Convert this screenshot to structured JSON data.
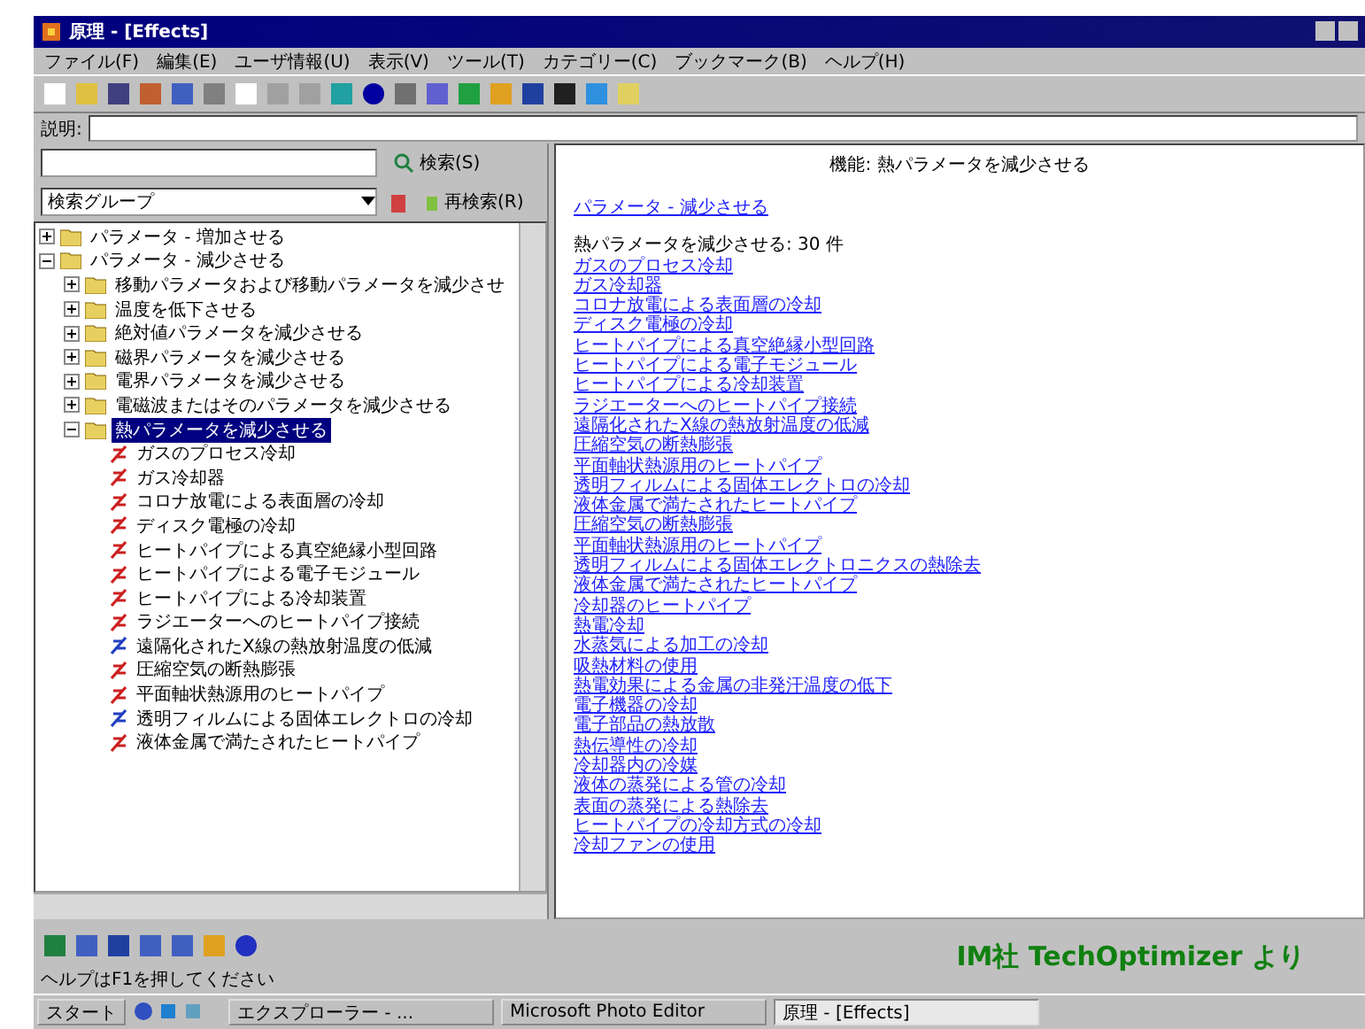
{
  "window": {
    "title": "原理 - [Effects]"
  },
  "menu": [
    "ファイル(F)",
    "編集(E)",
    "ユーザ情報(U)",
    "表示(V)",
    "ツール(T)",
    "カテゴリー(C)",
    "ブックマーク(B)",
    "ヘルプ(H)"
  ],
  "address": {
    "label": "説明:"
  },
  "search": {
    "button": "検索(S)",
    "group": "検索グループ",
    "reset_button": "再検索(R)"
  },
  "tree": [
    {
      "label": "パラメータ - 増加させる",
      "kind": "folder",
      "expanded": false,
      "selected": false
    },
    {
      "label": "パラメータ - 減少させる",
      "kind": "folder",
      "expanded": true,
      "selected": false,
      "children": [
        {
          "label": "移動パラメータおよび移動パラメータを減少させ",
          "kind": "folder",
          "expanded": false,
          "selected": false
        },
        {
          "label": "温度を低下させる",
          "kind": "folder",
          "expanded": false,
          "selected": false
        },
        {
          "label": "絶対値パラメータを減少させる",
          "kind": "folder",
          "expanded": false,
          "selected": false
        },
        {
          "label": "磁界パラメータを減少させる",
          "kind": "folder",
          "expanded": false,
          "selected": false
        },
        {
          "label": "電界パラメータを減少させる",
          "kind": "folder",
          "expanded": false,
          "selected": false
        },
        {
          "label": "電磁波またはそのパラメータを減少させる",
          "kind": "folder",
          "expanded": false,
          "selected": false
        },
        {
          "label": "熱パラメータを減少させる",
          "kind": "folder",
          "expanded": true,
          "selected": true,
          "children": [
            {
              "label": "ガスのプロセス冷却",
              "kind": "effect",
              "color": "#cc2020",
              "selected": false
            },
            {
              "label": "ガス冷却器",
              "kind": "effect",
              "color": "#cc2020",
              "selected": false
            },
            {
              "label": "コロナ放電による表面層の冷却",
              "kind": "effect",
              "color": "#cc2020",
              "selected": false
            },
            {
              "label": "ディスク電極の冷却",
              "kind": "effect",
              "color": "#cc2020",
              "selected": false
            },
            {
              "label": "ヒートパイプによる真空絶縁小型回路",
              "kind": "effect",
              "color": "#cc2020",
              "selected": false
            },
            {
              "label": "ヒートパイプによる電子モジュール",
              "kind": "effect",
              "color": "#cc2020",
              "selected": false
            },
            {
              "label": "ヒートパイプによる冷却装置",
              "kind": "effect",
              "color": "#cc2020",
              "selected": false
            },
            {
              "label": "ラジエーターへのヒートパイプ接続",
              "kind": "effect",
              "color": "#cc2020",
              "selected": false
            },
            {
              "label": "遠隔化されたX線の熱放射温度の低減",
              "kind": "effect",
              "color": "#2040c0",
              "selected": false
            },
            {
              "label": "圧縮空気の断熱膨張",
              "kind": "effect",
              "color": "#cc2020",
              "selected": false
            },
            {
              "label": "平面軸状熱源用のヒートパイプ",
              "kind": "effect",
              "color": "#cc2020",
              "selected": false
            },
            {
              "label": "透明フィルムによる固体エレクトロの冷却",
              "kind": "effect",
              "color": "#2040c0",
              "selected": false
            },
            {
              "label": "液体金属で満たされたヒートパイプ",
              "kind": "effect",
              "color": "#cc2020",
              "selected": false
            }
          ]
        }
      ]
    }
  ],
  "detail": {
    "heading": "機能: 熱パラメータを減少させる",
    "parent_link": "パラメータ - 減少させる",
    "count": "熱パラメータを減少させる: 30 件",
    "links": [
      "ガスのプロセス冷却",
      "ガス冷却器",
      "コロナ放電による表面層の冷却",
      "ディスク電極の冷却",
      "ヒートパイプによる真空絶縁小型回路",
      "ヒートパイプによる電子モジュール",
      "ヒートパイプによる冷却装置",
      "ラジエーターへのヒートパイプ接続",
      "遠隔化されたX線の熱放射温度の低減",
      "圧縮空気の断熱膨張",
      "平面軸状熱源用のヒートパイプ",
      "透明フィルムによる固体エレクトロの冷却",
      "液体金属で満たされたヒートパイプ",
      "圧縮空気の断熱膨張",
      "平面軸状熱源用のヒートパイプ",
      "透明フィルムによる固体エレクトロニクスの熱除去",
      "液体金属で満たされたヒートパイプ",
      "冷却器のヒートパイプ",
      "熱電冷却",
      "水蒸気による加工の冷却",
      "吸熱材料の使用",
      "熱電効果による金属の非発汗温度の低下",
      "電子機器の冷却",
      "電子部品の熱放散",
      "熱伝導性の冷却",
      "冷却器内の冷媒",
      "液体の蒸発による管の冷却",
      "表面の蒸発による熱除去",
      "ヒートパイプの冷却方式の冷却",
      "冷却ファンの使用"
    ]
  },
  "status": "ヘルプはF1を押してください",
  "taskbar": {
    "start": "スタート",
    "tasks": [
      {
        "label": "エクスプローラー - ...",
        "selected": false
      },
      {
        "label": "Microsoft Photo Editor",
        "selected": false
      },
      {
        "label": "原理 - [Effects]",
        "selected": true
      }
    ]
  },
  "caption": "IM社 TechOptimizer より"
}
